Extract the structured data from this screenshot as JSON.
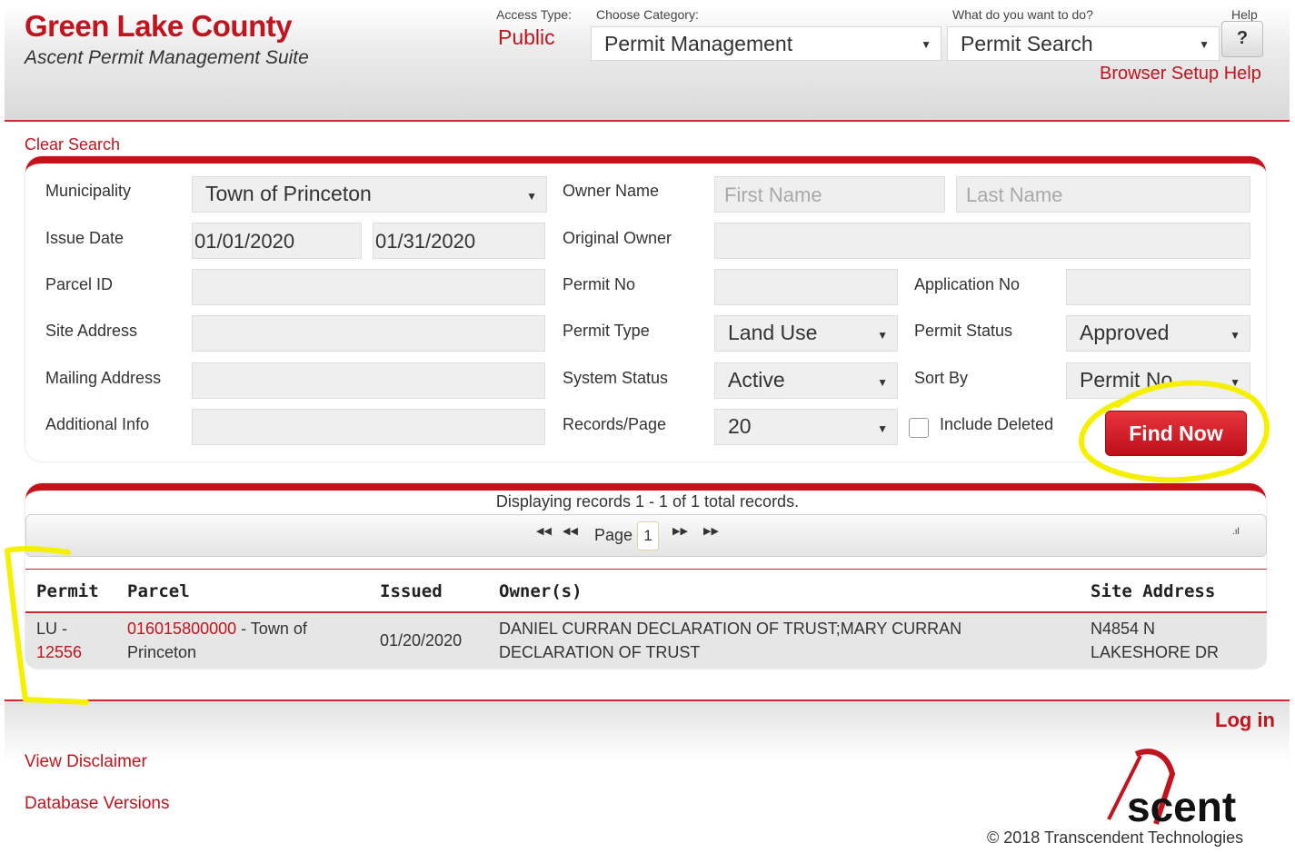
{
  "header": {
    "county": "Green Lake County",
    "suite": "Ascent Permit Management Suite",
    "access_type_label": "Access Type:",
    "access_type_value": "Public",
    "category_label": "Choose Category:",
    "category_value": "Permit Management",
    "action_label": "What do you want to do?",
    "action_value": "Permit Search",
    "help_label": "Help",
    "help_button": "?",
    "browser_setup_help": "Browser Setup Help"
  },
  "clear_search": "Clear Search",
  "search": {
    "municipality_label": "Municipality",
    "municipality_value": "Town of Princeton",
    "owner_name_label": "Owner Name",
    "first_name_placeholder": "First Name",
    "last_name_placeholder": "Last Name",
    "issue_date_label": "Issue Date",
    "issue_date_from": "01/01/2020",
    "issue_date_to": "01/31/2020",
    "original_owner_label": "Original Owner",
    "parcel_id_label": "Parcel ID",
    "permit_no_label": "Permit No",
    "application_no_label": "Application No",
    "site_address_label": "Site Address",
    "permit_type_label": "Permit Type",
    "permit_type_value": "Land Use",
    "permit_status_label": "Permit Status",
    "permit_status_value": "Approved",
    "mailing_address_label": "Mailing Address",
    "system_status_label": "System Status",
    "system_status_value": "Active",
    "sort_by_label": "Sort By",
    "sort_by_value": "Permit No",
    "additional_info_label": "Additional Info",
    "records_page_label": "Records/Page",
    "records_page_value": "20",
    "include_deleted_label": "Include Deleted",
    "find_now": "Find Now"
  },
  "results": {
    "summary": "Displaying records 1 - 1 of 1 total records.",
    "page_label": "Page",
    "page_number": "1",
    "columns": [
      "Permit",
      "Parcel",
      "Issued",
      "Owner(s)",
      "Site Address"
    ],
    "rows": [
      {
        "permit_prefix": "LU -",
        "permit_link": "12556",
        "parcel_link": "016015800000",
        "parcel_suffix_1": " - Town of",
        "parcel_suffix_2": "Princeton",
        "issued": "01/20/2020",
        "owners_1": "DANIEL CURRAN DECLARATION OF TRUST;MARY CURRAN",
        "owners_2": "DECLARATION OF TRUST",
        "site_1": "N4854 N",
        "site_2": "LAKESHORE DR"
      }
    ]
  },
  "footer": {
    "login": "Log in",
    "view_disclaimer": "View Disclaimer",
    "database_versions": "Database Versions",
    "logo_text": "Ascent",
    "copyright": "© 2018 Transcendent Technologies"
  },
  "colors": {
    "brand_red": "#c0141e",
    "annotation_yellow": "#f5f000"
  }
}
